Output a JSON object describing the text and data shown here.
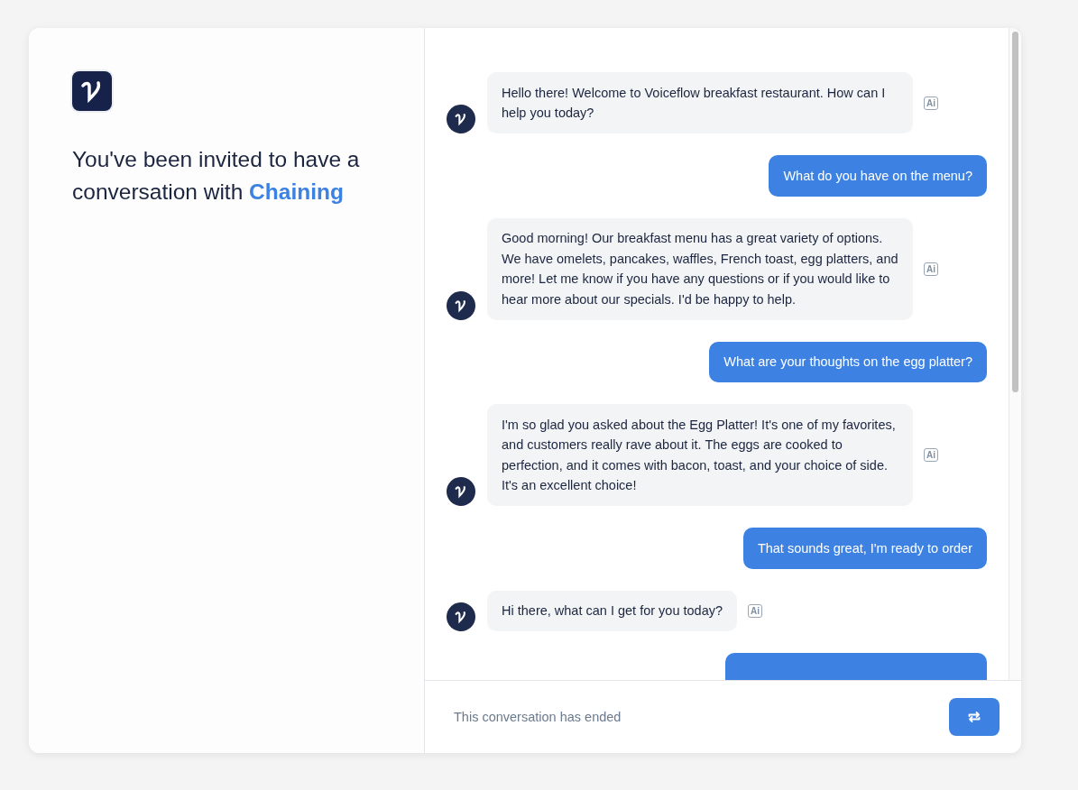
{
  "invite": {
    "text": "You've been invited to have a conversation with",
    "assistant_name": "Chaining"
  },
  "messages": [
    {
      "kind": "bot",
      "text": "Hello there! Welcome to Voiceflow breakfast restaurant. How can I help you today?",
      "badge": "Ai"
    },
    {
      "kind": "user",
      "text": "What do you have on the menu?"
    },
    {
      "kind": "bot",
      "text": "Good morning! Our breakfast menu has a great variety of options. We have omelets, pancakes, waffles, French toast, egg platters, and more! Let me know if you have any questions or if you would like to hear more about our specials. I'd be happy to help.",
      "badge": "Ai"
    },
    {
      "kind": "user",
      "text": "What are your thoughts on the egg platter?"
    },
    {
      "kind": "bot",
      "text": "I'm so glad you asked about the Egg Platter! It's one of my favorites, and customers really rave about it. The eggs are cooked to perfection, and it comes with bacon, toast, and your choice of side. It's an excellent choice!",
      "badge": "Ai"
    },
    {
      "kind": "user",
      "text": "That sounds great, I'm ready to order"
    },
    {
      "kind": "bot",
      "text": "Hi there, what can I get for you today?",
      "badge": "Ai"
    },
    {
      "kind": "user"
    }
  ],
  "footer": {
    "status": "This conversation has ended"
  }
}
